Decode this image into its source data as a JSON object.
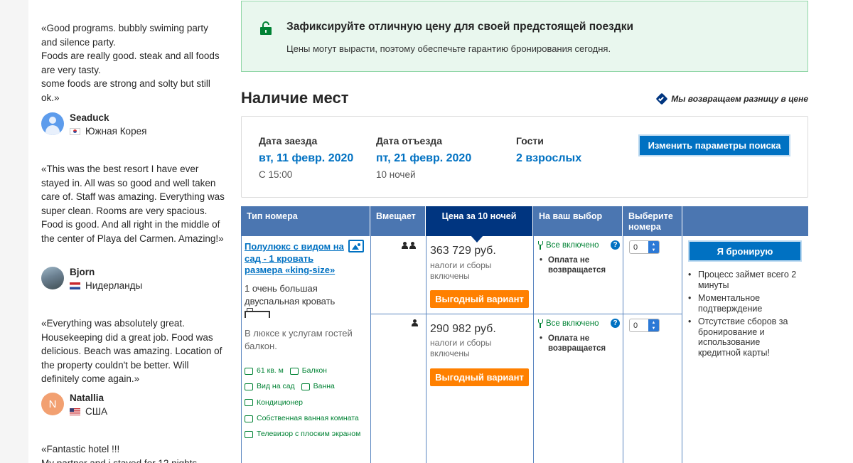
{
  "reviews": [
    {
      "text": "«Good programs. bubbly swiming party and silence party.\nFoods are really good. steak and all foods are very tasty.\nsome foods are strong and solty but still ok.»",
      "name": "Seaduck",
      "country": "Южная Корея",
      "flag": "kr"
    },
    {
      "text": "«This was the best resort I have ever stayed in. All was so good and well taken care of. Staff was amazing. Everything was super clean. Rooms are very spacious. Food is good. And all right in the middle of the center of Playa del Carmen. Amazing!»",
      "name": "Bjorn",
      "country": "Нидерланды",
      "flag": "nl"
    },
    {
      "text": "«Everything was absolutely great. Housekeeping did a great job. Food was delicious. Beach was amazing. Location of the property couldn't be better. Will definitely come again.»",
      "name": "Natallia",
      "initial": "N",
      "country": "США",
      "flag": "us"
    },
    {
      "text": "«Fantastic hotel !!!\nMy partner and i stayed for 12 nights"
    }
  ],
  "banner": {
    "title": "Зафиксируйте отличную цену для своей предстоящей поездки",
    "subtitle": "Цены могут вырасти, поэтому обеспечьте гарантию бронирования сегодня.",
    "icon": "unlock-icon",
    "color": "#008234"
  },
  "availability": {
    "title": "Наличие мест",
    "price_match": "Мы возвращаем разницу в цене"
  },
  "search": {
    "checkin_label": "Дата заезда",
    "checkin_value": "вт, 11 февр. 2020",
    "checkin_note": "С 15:00",
    "checkout_label": "Дата отъезда",
    "checkout_value": "пт, 21 февр. 2020",
    "checkout_note": "10 ночей",
    "guests_label": "Гости",
    "guests_value": "2 взрослых",
    "change_button": "Изменить параметры поиска"
  },
  "table": {
    "headers": {
      "room_type": "Тип номера",
      "sleeps": "Вмещает",
      "price": "Цена за 10 ночей",
      "choice": "На ваш выбор",
      "select": "Выберите номера"
    },
    "room": {
      "name": "Полулюкс с видом на сад - 1 кровать размера «king-size»",
      "bed": "1 очень большая двуспальная кровать",
      "description": "В люксе к услугам гостей балкон.",
      "facilities": [
        "61 кв. м",
        "Балкон",
        "Вид на сад",
        "Ванна",
        "Кондиционер",
        "Собственная ванная комната",
        "Телевизор с плоским экраном"
      ]
    },
    "options": [
      {
        "guests": 2,
        "price": "363 729 руб.",
        "price_note": "налоги и сборы включены",
        "badge": "Выгодный вариант",
        "included": "Все включено",
        "policy": "Оплата не возвращается",
        "qty": "0"
      },
      {
        "guests": 1,
        "price": "290 982 руб.",
        "price_note": "налоги и сборы включены",
        "badge": "Выгодный вариант",
        "included": "Все включено",
        "policy": "Оплата не возвращается",
        "qty": "0"
      }
    ],
    "book_button": "Я бронирую",
    "benefits": [
      "Процесс займет всего 2 минуты",
      "Моментальное подтверждение",
      "Отсутствие сборов за бронирование и использование кредитной карты!"
    ]
  },
  "colors": {
    "brand_blue": "#003580",
    "link_blue": "#0071c2",
    "header_blue": "#4b76b1",
    "deal_orange": "#ff8000",
    "green": "#008234"
  }
}
